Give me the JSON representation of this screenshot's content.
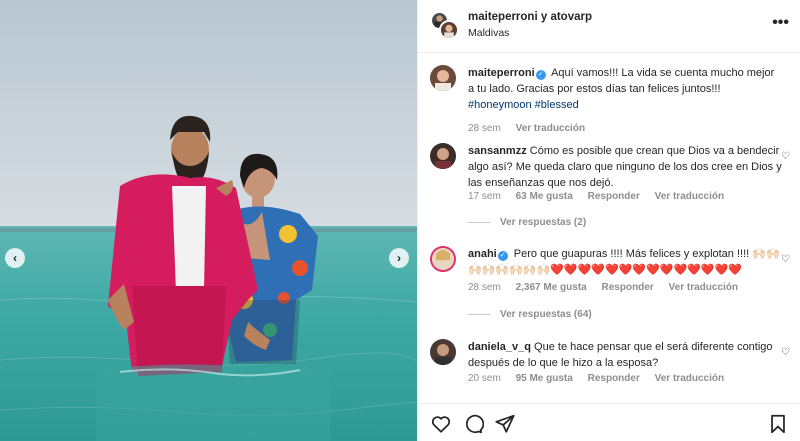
{
  "post": {
    "nav_prev": "‹",
    "nav_next": "›"
  },
  "header": {
    "title": "maiteperroni y atovarp",
    "location": "Maldivas",
    "more": "•••"
  },
  "caption": {
    "user": "maiteperroni",
    "text": "Aquí vamos!!! La vida se cuenta mucho mejor a tu lado. Gracias por estos días tan felices juntos!!!",
    "hashtags": "#honeymoon #blessed",
    "time": "28 sem",
    "translate": "Ver traducción"
  },
  "comments": [
    {
      "user": "sansanmzz",
      "text": "Cómo es posible que crean que Dios va a bendecir algo así? Me queda claro que ninguno de los dos cree en Dios y las enseñanzas que nos dejó.",
      "time": "17 sem",
      "likes": "63 Me gusta",
      "reply": "Responder",
      "translate": "Ver traducción",
      "replies": "Ver respuestas (2)"
    },
    {
      "user": "anahi",
      "text": "Pero que guapuras !!!! Más felices y explotan !!!! 🙌🏻🙌🏻🙌🏻🙌🏻🙌🏻🙌🏻🙌🏻🙌🏻❤️❤️❤️❤️❤️❤️❤️❤️❤️❤️❤️❤️❤️❤️",
      "time": "28 sem",
      "likes": "2,367 Me gusta",
      "reply": "Responder",
      "translate": "Ver traducción",
      "replies": "Ver respuestas (64)"
    },
    {
      "user": "daniela_v_q",
      "text": "Que te hace pensar que el será diferente contigo después de lo que le hizo a la esposa?",
      "time": "20 sem",
      "likes": "95 Me gusta",
      "reply": "Responder",
      "translate": "Ver traducción"
    }
  ],
  "icons": {
    "heart": "♡",
    "verified": "✓"
  },
  "colors": {
    "verified_blue": "#3897f0",
    "hashtag": "#00376b",
    "muted": "#8e8e8e",
    "heart_red": "#ed1b2e"
  }
}
